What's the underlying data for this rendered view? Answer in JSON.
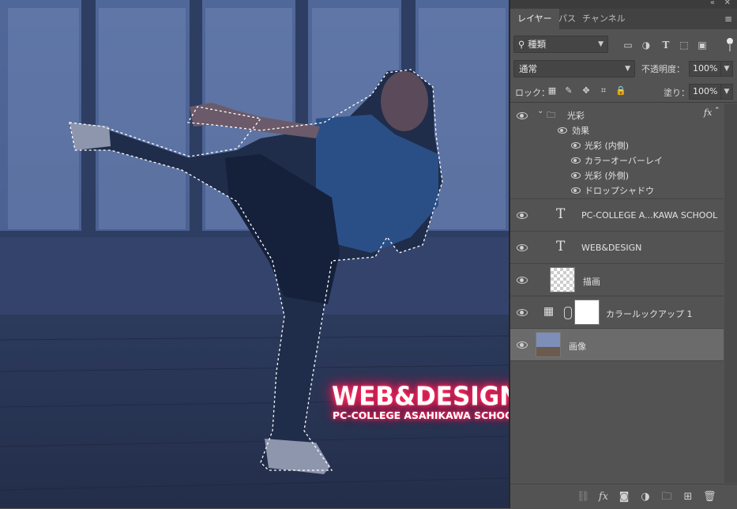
{
  "canvas": {
    "image_name": "画像",
    "overlay_title": "WEB&DESIGN",
    "overlay_subtitle": "PC-COLLEGE ASAHIKAWA SCHOOL",
    "glow_color": "#ff1450"
  },
  "panel": {
    "tabs": [
      {
        "label": "レイヤー",
        "active": true
      },
      {
        "label": "パス",
        "active": false
      },
      {
        "label": "チャンネル",
        "active": false
      }
    ],
    "filter_kind": "種類",
    "blend_mode": "通常",
    "opacity_label": "不透明度：",
    "opacity_value": "100%",
    "lock_label": "ロック：",
    "fill_label": "塗り：",
    "fill_value": "100%",
    "layers": [
      {
        "name": "光彩",
        "type": "group",
        "fx": "fx",
        "effects_label": "効果",
        "effects": [
          "光彩 (内側)",
          "カラーオーバーレイ",
          "光彩 (外側)",
          "ドロップシャドウ"
        ]
      },
      {
        "name": "PC-COLLEGE A...KAWA SCHOOL",
        "type": "text"
      },
      {
        "name": "WEB&DESIGN",
        "type": "text"
      },
      {
        "name": "描画",
        "type": "pixel"
      },
      {
        "name": "カラールックアップ 1",
        "type": "adjustment"
      },
      {
        "name": "画像",
        "type": "image",
        "selected": true
      }
    ],
    "text_glyph": "T"
  },
  "colors": {
    "panel_bg": "#535353",
    "selected_row": "#6b6b6b",
    "canvas_tint": "#2f3f66"
  }
}
